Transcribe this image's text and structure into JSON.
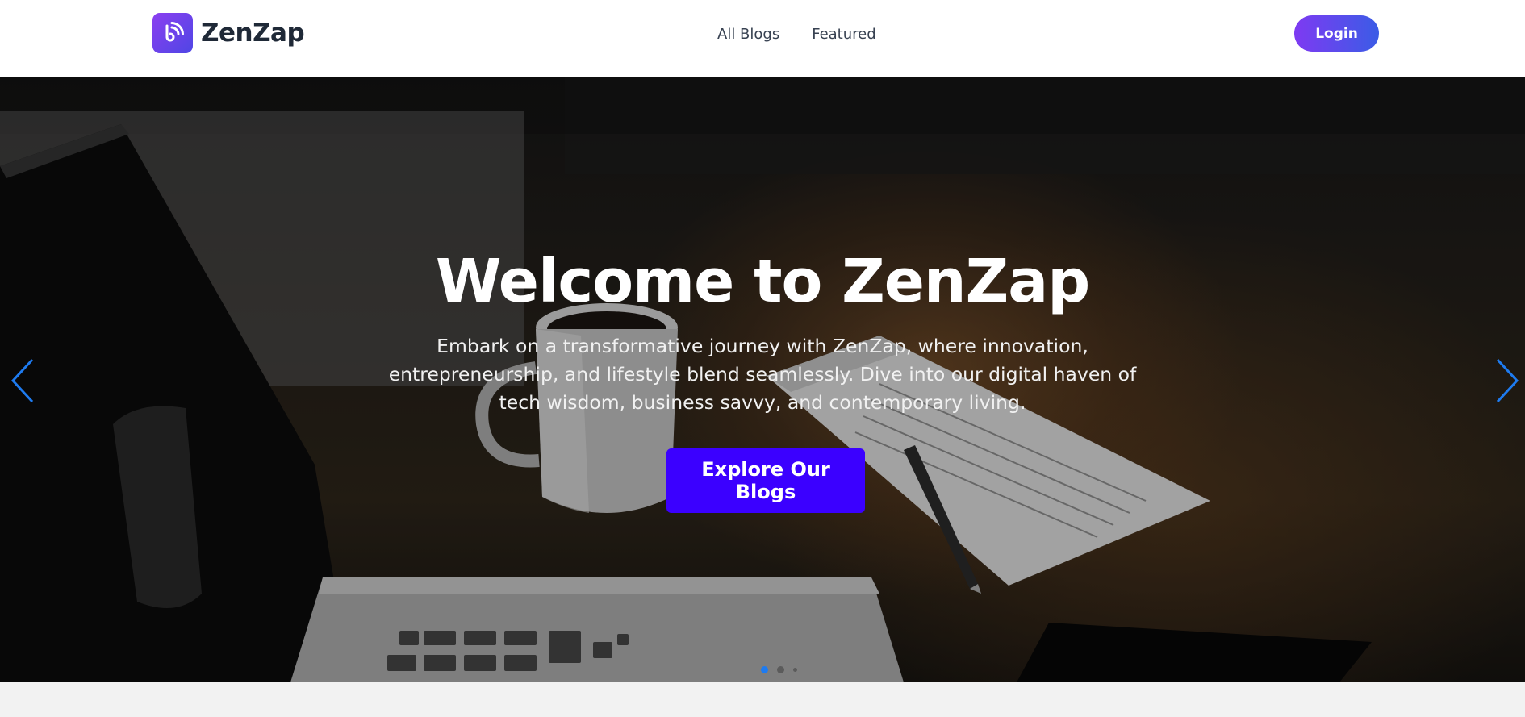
{
  "brand": {
    "name": "ZenZap",
    "logo_icon": "rss-feed-icon"
  },
  "nav": {
    "links": [
      {
        "label": "All Blogs"
      },
      {
        "label": "Featured"
      }
    ],
    "login_label": "Login"
  },
  "hero": {
    "title": "Welcome to ZenZap",
    "text": "Embark on a transformative journey with ZenZap, where innovation, entrepreneurship, and lifestyle blend seamlessly. Dive into our digital haven of tech wisdom, business savvy, and contemporary living.",
    "cta_label": "Explore Our Blogs",
    "prev_icon": "chevron-left-icon",
    "next_icon": "chevron-right-icon",
    "slides": [
      {
        "active": true
      },
      {
        "active": false
      },
      {
        "active": false
      }
    ]
  },
  "colors": {
    "accent": "#3b00ff",
    "login_start": "#7e3af2",
    "login_end": "#3b5ce6",
    "arrow": "#1e7bf0"
  }
}
